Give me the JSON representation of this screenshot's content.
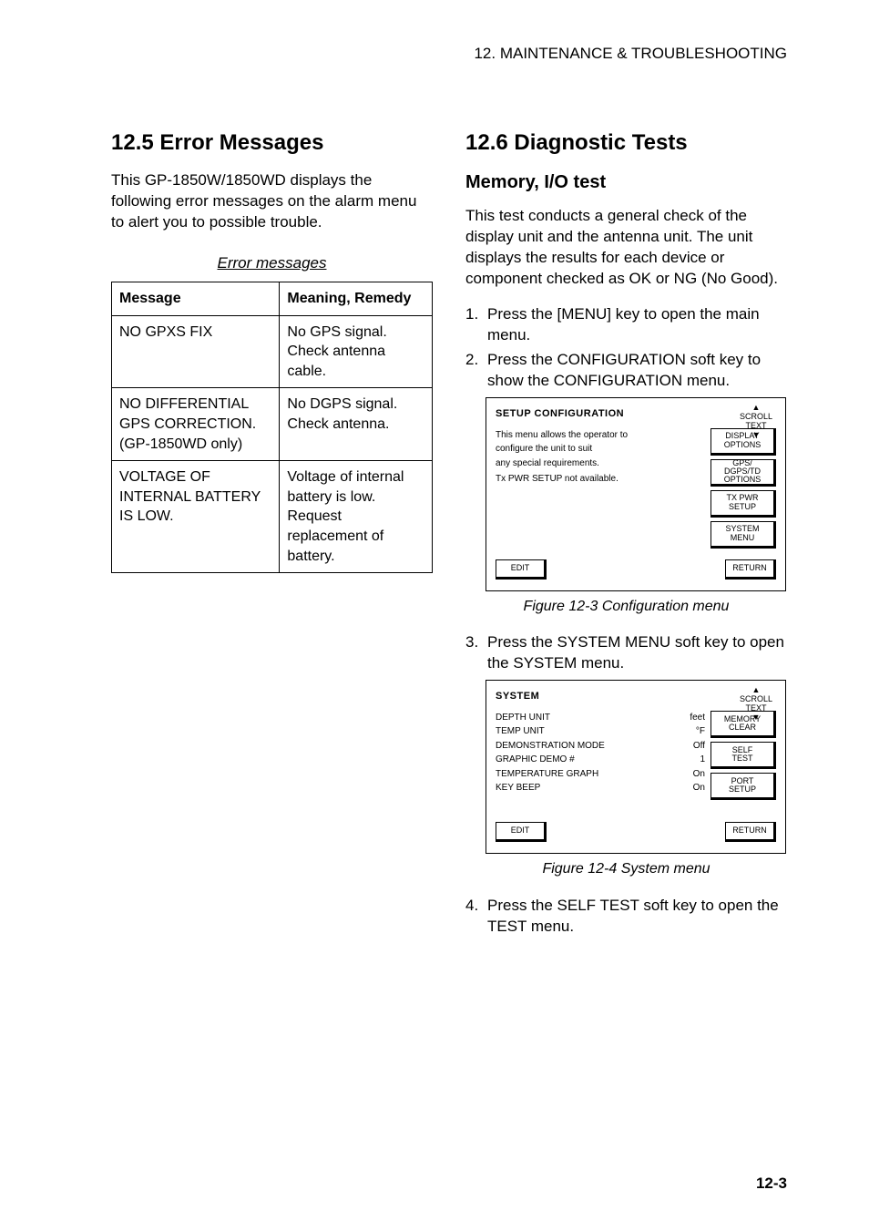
{
  "header": "12. MAINTENANCE & TROUBLESHOOTING",
  "left": {
    "section_no": "12.5",
    "section_title": "Error Messages",
    "intro": "This GP-1850W/1850WD displays the following error messages on the alarm menu to alert you to possible trouble.",
    "table_caption": "Error messages",
    "col_msg": "Message",
    "col_meaning": "Meaning, Remedy",
    "rows": [
      {
        "msg": "NO GPXS FIX",
        "meaning": "No GPS signal. Check antenna cable."
      },
      {
        "msg": "NO DIFFERENTIAL GPS CORRECTION. (GP-1850WD only)",
        "meaning": "No DGPS signal. Check antenna."
      },
      {
        "msg": "VOLTAGE OF INTERNAL BATTERY IS LOW.",
        "meaning": "Voltage of internal battery is low. Request replacement of battery."
      }
    ]
  },
  "right": {
    "section_no": "12.6",
    "section_title": "Diagnostic Tests",
    "sub_title": "Memory, I/O test",
    "intro": "This test conducts a general check of the display unit and the antenna unit. The unit displays the results for each device or component checked as OK or NG (No Good).",
    "steps1": [
      "Press the [MENU] key to open the main menu.",
      "Press the CONFIGURATION soft key to show the CONFIGURATION menu."
    ],
    "menu1": {
      "title": "SETUP CONFIGURATION",
      "scroll_label": "SCROLL\nTEXT",
      "left_lines": [
        "This menu allows the operator to",
        "configure the unit to suit",
        "any special requirements.",
        "",
        "Tx PWR SETUP not available."
      ],
      "buttons": [
        "DISPLAY\nOPTIONS",
        "GPS/\nDGPS/TD\nOPTIONS",
        "TX PWR\nSETUP",
        "SYSTEM\nMENU"
      ],
      "bottom_left": "EDIT",
      "bottom_right": "RETURN"
    },
    "fig1": "Figure 12-3 Configuration menu",
    "steps2": [
      "Press the SYSTEM MENU soft key to open the SYSTEM menu."
    ],
    "menu2": {
      "title": "SYSTEM",
      "scroll_label": "SCROLL\nTEXT",
      "left_cols": [
        [
          "DEPTH UNIT",
          "feet"
        ],
        [
          "TEMP UNIT",
          "°F"
        ],
        [
          "DEMONSTRATION MODE",
          "Off"
        ],
        [
          "GRAPHIC DEMO #",
          "1"
        ],
        [
          "TEMPERATURE GRAPH",
          "On"
        ],
        [
          "KEY BEEP",
          "On"
        ]
      ],
      "buttons": [
        "MEMORY\nCLEAR",
        "SELF\nTEST",
        "PORT\nSETUP"
      ],
      "bottom_left": "EDIT",
      "bottom_right": "RETURN"
    },
    "fig2": "Figure 12-4 System menu",
    "steps3": [
      "Press the SELF TEST soft key to open the TEST menu."
    ]
  },
  "page_num": "12-3"
}
